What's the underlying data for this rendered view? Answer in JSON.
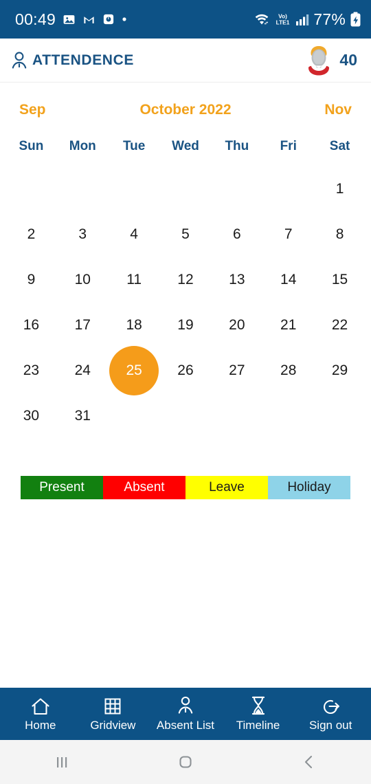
{
  "status_bar": {
    "clock": "00:49",
    "battery": "77%",
    "network_label": "LTE1",
    "volte_label": "Vo)",
    "icons": [
      "gallery-icon",
      "gmail-icon",
      "app-icon",
      "dot-icon",
      "wifi-icon",
      "volte-icon",
      "signal-icon",
      "battery-charging-icon"
    ],
    "background": "#0d5286"
  },
  "header": {
    "title": "ATTENDENCE",
    "person_icon": "person-icon",
    "avatar_icon": "avatar-icon",
    "count": "40",
    "title_color": "#1a5383"
  },
  "month_nav": {
    "prev_month": "Sep",
    "current_month": "October 2022",
    "next_month": "Nov",
    "accent_color": "#f2a21c"
  },
  "calendar": {
    "weekdays": [
      "Sun",
      "Mon",
      "Tue",
      "Wed",
      "Thu",
      "Fri",
      "Sat"
    ],
    "leading_blanks": 6,
    "days": [
      1,
      2,
      3,
      4,
      5,
      6,
      7,
      8,
      9,
      10,
      11,
      12,
      13,
      14,
      15,
      16,
      17,
      18,
      19,
      20,
      21,
      22,
      23,
      24,
      25,
      26,
      27,
      28,
      29,
      30,
      31
    ],
    "selected_day": 25,
    "selected_color": "#f59c1a",
    "weekday_color": "#1a5383"
  },
  "legend": {
    "items": [
      {
        "label": "Present",
        "bg": "#128010",
        "fg": "#ffffff"
      },
      {
        "label": "Absent",
        "bg": "#ff0000",
        "fg": "#ffffff"
      },
      {
        "label": "Leave",
        "bg": "#ffff00",
        "fg": "#1b1b1b"
      },
      {
        "label": "Holiday",
        "bg": "#8ed3e8",
        "fg": "#1b1b1b"
      }
    ]
  },
  "bottom_nav": {
    "background": "#0d5286",
    "items": [
      {
        "label": "Home",
        "icon": "home-icon"
      },
      {
        "label": "Gridview",
        "icon": "grid-icon"
      },
      {
        "label": "Absent List",
        "icon": "person-icon"
      },
      {
        "label": "Timeline",
        "icon": "hourglass-icon"
      },
      {
        "label": "Sign out",
        "icon": "sign-out-icon"
      }
    ]
  },
  "system_nav": {
    "recents": "recents-icon",
    "home": "home-square-icon",
    "back": "back-chevron-icon"
  }
}
